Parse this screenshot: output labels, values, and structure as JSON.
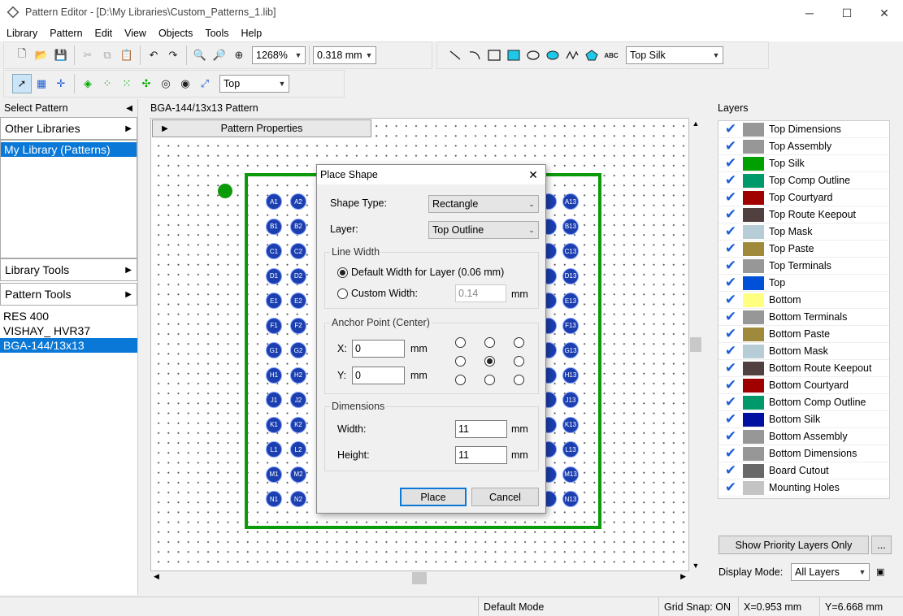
{
  "window": {
    "title": "Pattern Editor - [D:\\My Libraries\\Custom_Patterns_1.lib]",
    "minimize": "─",
    "maximize": "☐",
    "close": "✕"
  },
  "menu": [
    "Library",
    "Pattern",
    "Edit",
    "View",
    "Objects",
    "Tools",
    "Help"
  ],
  "toolbar": {
    "zoom": "1268%",
    "grid": "0.318 mm",
    "layer_select": "Top Silk",
    "side_select": "Top"
  },
  "left": {
    "header": "Select Pattern",
    "other_libraries": "Other Libraries",
    "my_library": "My Library (Patterns)",
    "library_tools": "Library Tools",
    "pattern_tools": "Pattern Tools",
    "patterns": [
      "RES 400",
      "VISHAY_ HVR37",
      "BGA-144/13x13"
    ]
  },
  "canvas": {
    "title": "BGA-144/13x13 Pattern",
    "properties_tab": "Pattern Properties",
    "rows": [
      "A",
      "B",
      "C",
      "D",
      "E",
      "F",
      "G",
      "H",
      "J",
      "K",
      "L",
      "M",
      "N"
    ],
    "right_labels": [
      "A13",
      "B13",
      "C13",
      "D13",
      "E13",
      "F13",
      "G13",
      "H13",
      "J13",
      "K13",
      "L13",
      "M13",
      "N13"
    ]
  },
  "dialog": {
    "title": "Place Shape",
    "shape_type_label": "Shape Type:",
    "shape_type": "Rectangle",
    "layer_label": "Layer:",
    "layer": "Top Outline",
    "line_width_group": "Line Width",
    "default_width": "Default Width for Layer (0.06 mm)",
    "custom_width": "Custom Width:",
    "custom_value": "0.14",
    "unit": "mm",
    "anchor_group": "Anchor Point (Center)",
    "x_label": "X:",
    "x_value": "0",
    "y_label": "Y:",
    "y_value": "0",
    "dimensions_group": "Dimensions",
    "width_label": "Width:",
    "width_value": "11",
    "height_label": "Height:",
    "height_value": "11",
    "place": "Place",
    "cancel": "Cancel"
  },
  "layers": {
    "header": "Layers",
    "items": [
      {
        "name": "Top Dimensions",
        "color": "#979797"
      },
      {
        "name": "Top Assembly",
        "color": "#979797"
      },
      {
        "name": "Top Silk",
        "color": "#00a000"
      },
      {
        "name": "Top Comp Outline",
        "color": "#009a6a"
      },
      {
        "name": "Top Courtyard",
        "color": "#a00000"
      },
      {
        "name": "Top Route Keepout",
        "color": "#504040"
      },
      {
        "name": "Top Mask",
        "color": "#b6cdd8"
      },
      {
        "name": "Top Paste",
        "color": "#9e8a3a"
      },
      {
        "name": "Top Terminals",
        "color": "#979797"
      },
      {
        "name": "Top",
        "color": "#0050d8"
      },
      {
        "name": "Bottom",
        "color": "#ffff80"
      },
      {
        "name": "Bottom Terminals",
        "color": "#979797"
      },
      {
        "name": "Bottom Paste",
        "color": "#9e8a3a"
      },
      {
        "name": "Bottom Mask",
        "color": "#b6cdd8"
      },
      {
        "name": "Bottom Route Keepout",
        "color": "#504040"
      },
      {
        "name": "Bottom Courtyard",
        "color": "#a00000"
      },
      {
        "name": "Bottom Comp Outline",
        "color": "#009a6a"
      },
      {
        "name": "Bottom Silk",
        "color": "#0010a0"
      },
      {
        "name": "Bottom Assembly",
        "color": "#979797"
      },
      {
        "name": "Bottom Dimensions",
        "color": "#979797"
      },
      {
        "name": "Board Cutout",
        "color": "#686868"
      },
      {
        "name": "Mounting Holes",
        "color": "#c4c4c4"
      }
    ],
    "show_priority": "Show Priority Layers Only",
    "more": "...",
    "display_mode_label": "Display Mode:",
    "display_mode": "All Layers"
  },
  "status": {
    "mode": "Default Mode",
    "snap": "Grid Snap: ON",
    "x": "X=0.953 mm",
    "y": "Y=6.668 mm"
  }
}
